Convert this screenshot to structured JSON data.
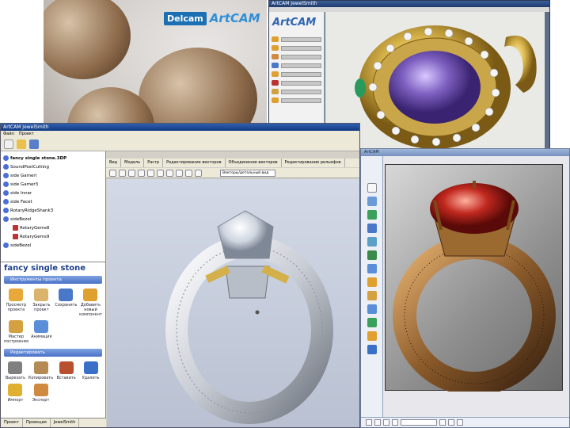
{
  "splash": {
    "delcam_logo": "Delcam",
    "artcam_logo": "ArtCAM"
  },
  "pendant_window": {
    "title": "ArtCAM JewelSmith",
    "panel_logo": "ArtCAM"
  },
  "jewelsmith": {
    "title": "ArtCAM JewelSmith",
    "menu": [
      "Файл",
      "Проект"
    ],
    "view_tabs": [
      "Вид",
      "Модель",
      "Растр",
      "Редактирование векторов",
      "Объединение векторов",
      "Редактирование рельефов"
    ],
    "view_dropdown": "Векторы/детальный вид",
    "tree_items": [
      {
        "label": "fancy single stone.3DP",
        "kind": "root"
      },
      {
        "label": "SoundPostCutting",
        "kind": "item"
      },
      {
        "label": "side Gamerl",
        "kind": "item"
      },
      {
        "label": "side Gamer3",
        "kind": "item"
      },
      {
        "label": "side Inner",
        "kind": "item"
      },
      {
        "label": "side Facet",
        "kind": "item"
      },
      {
        "label": "RotaryRidgeShank3",
        "kind": "item"
      },
      {
        "label": "sideBezel",
        "kind": "item"
      },
      {
        "label": "RotaryGems8",
        "kind": "child"
      },
      {
        "label": "RotaryGems9",
        "kind": "child"
      },
      {
        "label": "sideBezel",
        "kind": "item"
      }
    ],
    "project_title": "fancy single stone",
    "project_tools_header": "Инструменты проекта",
    "project_tools": [
      {
        "label": "Просмотр проекта",
        "color": "#e9a93a"
      },
      {
        "label": "Закрыть проект",
        "color": "#d9b46a"
      },
      {
        "label": "Сохранить",
        "color": "#4a78c8"
      },
      {
        "label": "Добавить новый компонент",
        "color": "#e0a030"
      },
      {
        "label": "Мастер построения",
        "color": "#d4a040"
      },
      {
        "label": "Анимация",
        "color": "#5a8ed8"
      }
    ],
    "edit_header": "Редактировать",
    "edit_tools": [
      {
        "label": "Вырезать",
        "color": "#808080"
      },
      {
        "label": "Копировать",
        "color": "#b58a55"
      },
      {
        "label": "Вставить",
        "color": "#b85030"
      },
      {
        "label": "Удалить",
        "color": "#3a70c8"
      },
      {
        "label": "Импорт",
        "color": "#e0b030"
      },
      {
        "label": "Экспорт",
        "color": "#d08a40"
      }
    ],
    "bottom_tabs": [
      "Проект",
      "Проекция",
      "JewelSmith"
    ]
  },
  "render_window": {
    "title": "ArtCAM"
  },
  "colors": {
    "window_chrome": "#d4d0c8",
    "titlebar_blue": "#123a82",
    "ring_gold": "#c9a64a",
    "stone_purple": "#7d5fc0",
    "stone_red": "#c0281e",
    "bronze": "#8a5a2a"
  }
}
